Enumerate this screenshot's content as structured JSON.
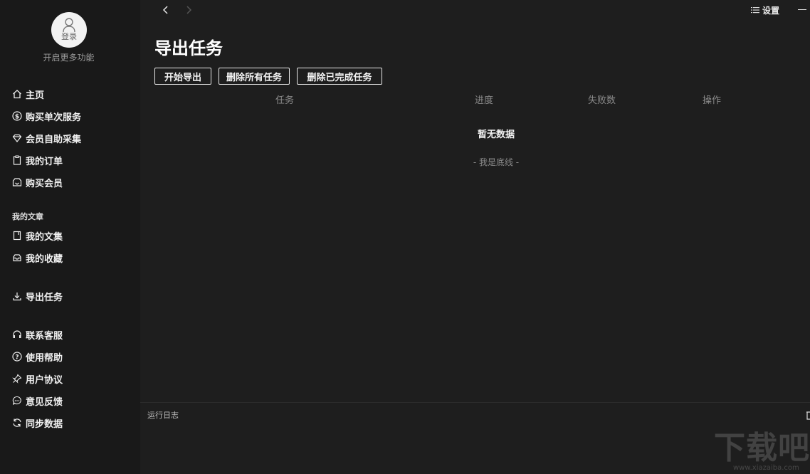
{
  "sidebar": {
    "avatar_label": "登录",
    "unlock_text": "开启更多功能",
    "items": [
      {
        "label": "主页",
        "icon": "home-icon"
      },
      {
        "label": "购买单次服务",
        "icon": "dollar-icon"
      },
      {
        "label": "会员自助采集",
        "icon": "crown-icon"
      },
      {
        "label": "我的订单",
        "icon": "clipboard-icon"
      },
      {
        "label": "购买会员",
        "icon": "gem-icon"
      }
    ],
    "section_title": "我的文章",
    "article_items": [
      {
        "label": "我的文集",
        "icon": "book-icon"
      },
      {
        "label": "我的收藏",
        "icon": "inbox-icon"
      }
    ],
    "export_item": {
      "label": "导出任务",
      "icon": "download-icon"
    },
    "support_items": [
      {
        "label": "联系客服",
        "icon": "headset-icon"
      },
      {
        "label": "使用帮助",
        "icon": "question-icon"
      },
      {
        "label": "用户协议",
        "icon": "pin-icon"
      },
      {
        "label": "意见反馈",
        "icon": "chat-icon"
      },
      {
        "label": "同步数据",
        "icon": "sync-icon"
      }
    ]
  },
  "topbar": {
    "settings_label": "设置"
  },
  "main": {
    "title": "导出任务",
    "buttons": {
      "start": "开始导出",
      "delete_all": "删除所有任务",
      "delete_done": "删除已完成任务"
    },
    "columns": [
      "任务",
      "进度",
      "失败数",
      "操作"
    ],
    "empty_text": "暂无数据",
    "bottom_line": "- 我是底线 -"
  },
  "log": {
    "label": "运行日志"
  },
  "watermark": {
    "text": "下载吧",
    "url": "www.xiazaiba.com"
  }
}
